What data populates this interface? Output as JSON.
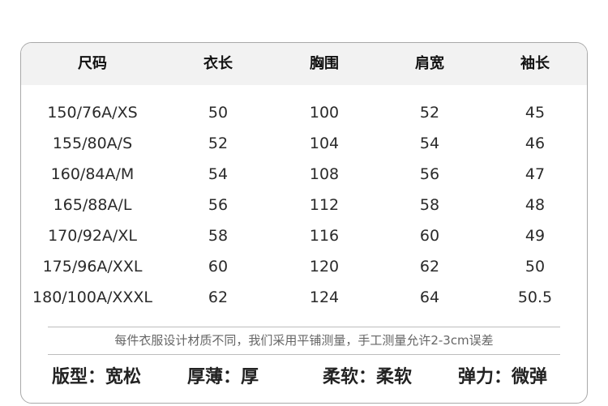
{
  "table": {
    "headers": [
      "尺码",
      "衣长",
      "胸围",
      "肩宽",
      "袖长"
    ],
    "rows": [
      [
        "150/76A/XS",
        "50",
        "100",
        "52",
        "45"
      ],
      [
        "155/80A/S",
        "52",
        "104",
        "54",
        "46"
      ],
      [
        "160/84A/M",
        "54",
        "108",
        "56",
        "47"
      ],
      [
        "165/88A/L",
        "56",
        "112",
        "58",
        "48"
      ],
      [
        "170/92A/XL",
        "58",
        "116",
        "60",
        "49"
      ],
      [
        "175/96A/XXL",
        "60",
        "120",
        "62",
        "50"
      ],
      [
        "180/100A/XXXL",
        "62",
        "124",
        "64",
        "50.5"
      ]
    ]
  },
  "note": "每件衣服设计材质不同，我们采用平铺测量，手工测量允许2-3cm误差",
  "properties": [
    {
      "label": "版型：宽松"
    },
    {
      "label": "厚薄：厚"
    },
    {
      "label": "柔软：柔软"
    },
    {
      "label": "弹力：微弹"
    }
  ],
  "colors": {
    "header_bg": "#f2f2f2",
    "border": "#a9a9a9",
    "text": "#222222",
    "note_text": "#666666"
  }
}
